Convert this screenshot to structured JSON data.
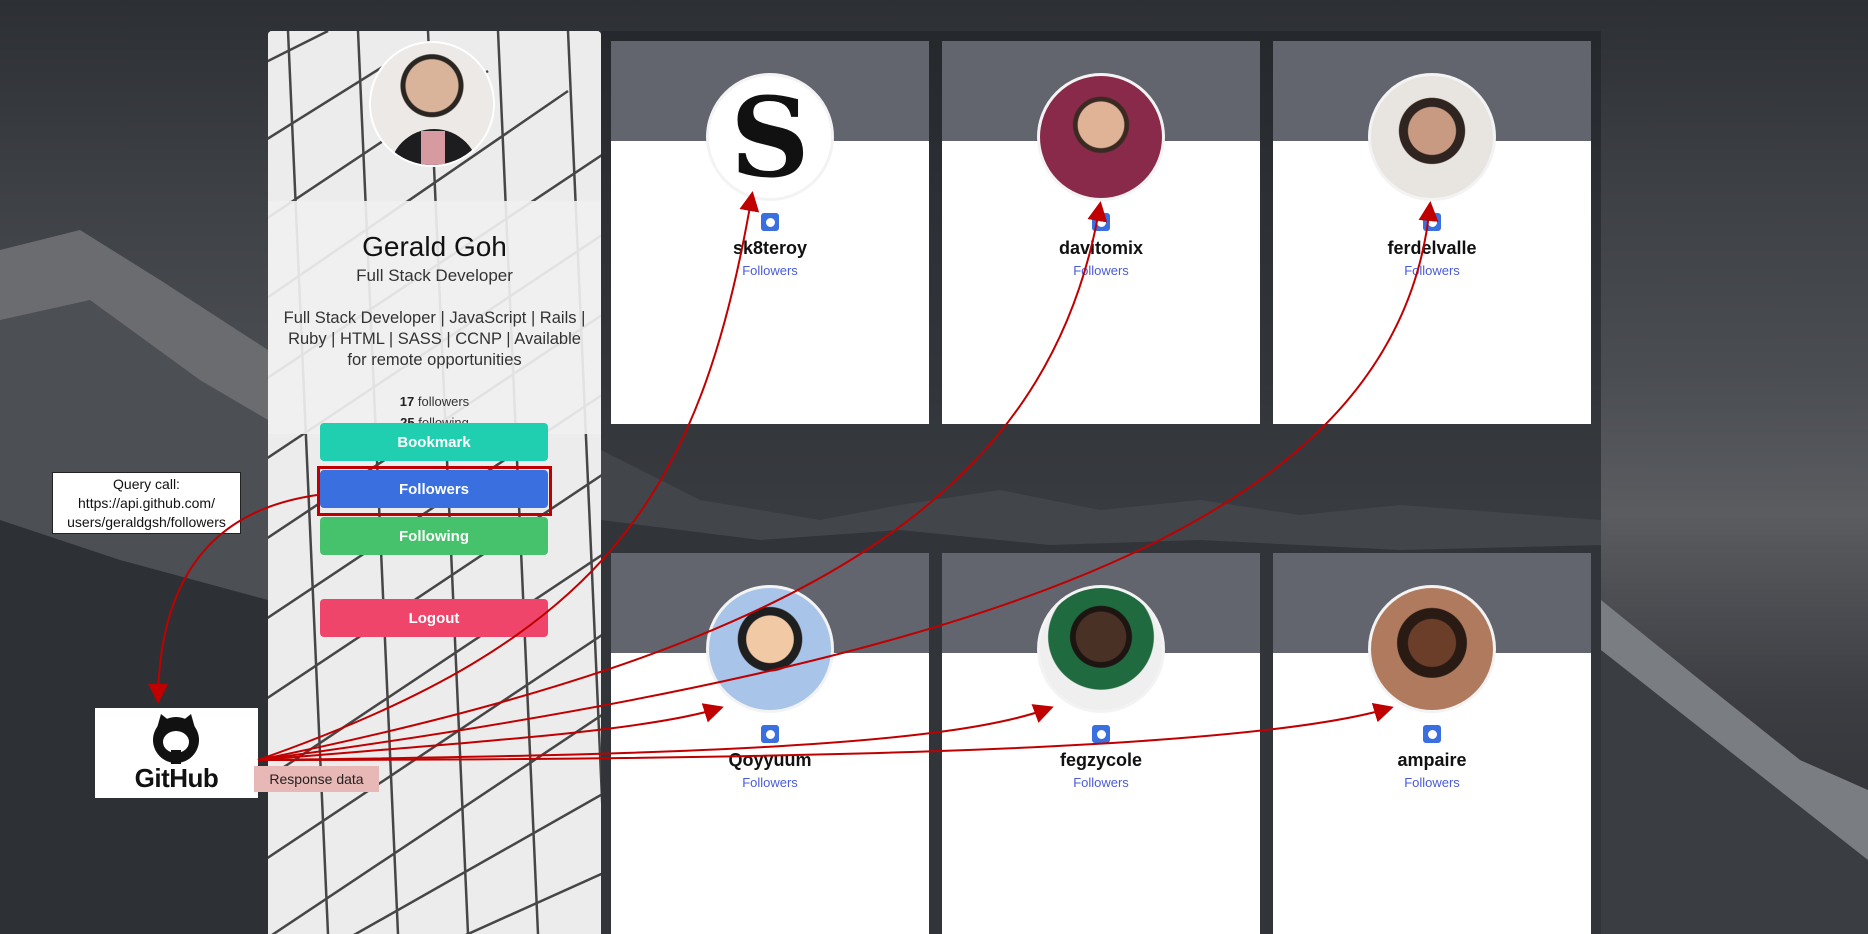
{
  "profile": {
    "name": "Gerald Goh",
    "title": "Full Stack Developer",
    "bio": "Full Stack Developer | JavaScript | Rails | Ruby | HTML | SASS | CCNP | Available for remote opportunities",
    "followers_count": "17",
    "followers_label": " followers",
    "following_count": "25",
    "following_label": " following"
  },
  "buttons": {
    "bookmark": "Bookmark",
    "followers": "Followers",
    "following": "Following",
    "logout": "Logout"
  },
  "cards": [
    {
      "login": "sk8teroy",
      "link": "Followers",
      "avatar": "gothic-s-logo"
    },
    {
      "login": "davitomix",
      "link": "Followers",
      "avatar": "person-glasses-photo"
    },
    {
      "login": "ferdelvalle",
      "link": "Followers",
      "avatar": "person-glasses-mustache-photo"
    },
    {
      "login": "Qoyyuum",
      "link": "Followers",
      "avatar": "cartoon-face"
    },
    {
      "login": "fegzycole",
      "link": "Followers",
      "avatar": "person-photo"
    },
    {
      "login": "ampaire",
      "link": "Followers",
      "avatar": "person-photo"
    }
  ],
  "annotations": {
    "query_line1": "Query call:",
    "query_line2": "https://api.github.com/",
    "query_line3": "users/geraldgsh/followers",
    "github_logo_text": "GitHub",
    "response_label": "Response data"
  },
  "colors": {
    "bookmark": "#1fcfb0",
    "followers": "#3a6fe0",
    "following": "#45c26b",
    "logout": "#f0456a",
    "annotation_arrow": "#c00000"
  }
}
